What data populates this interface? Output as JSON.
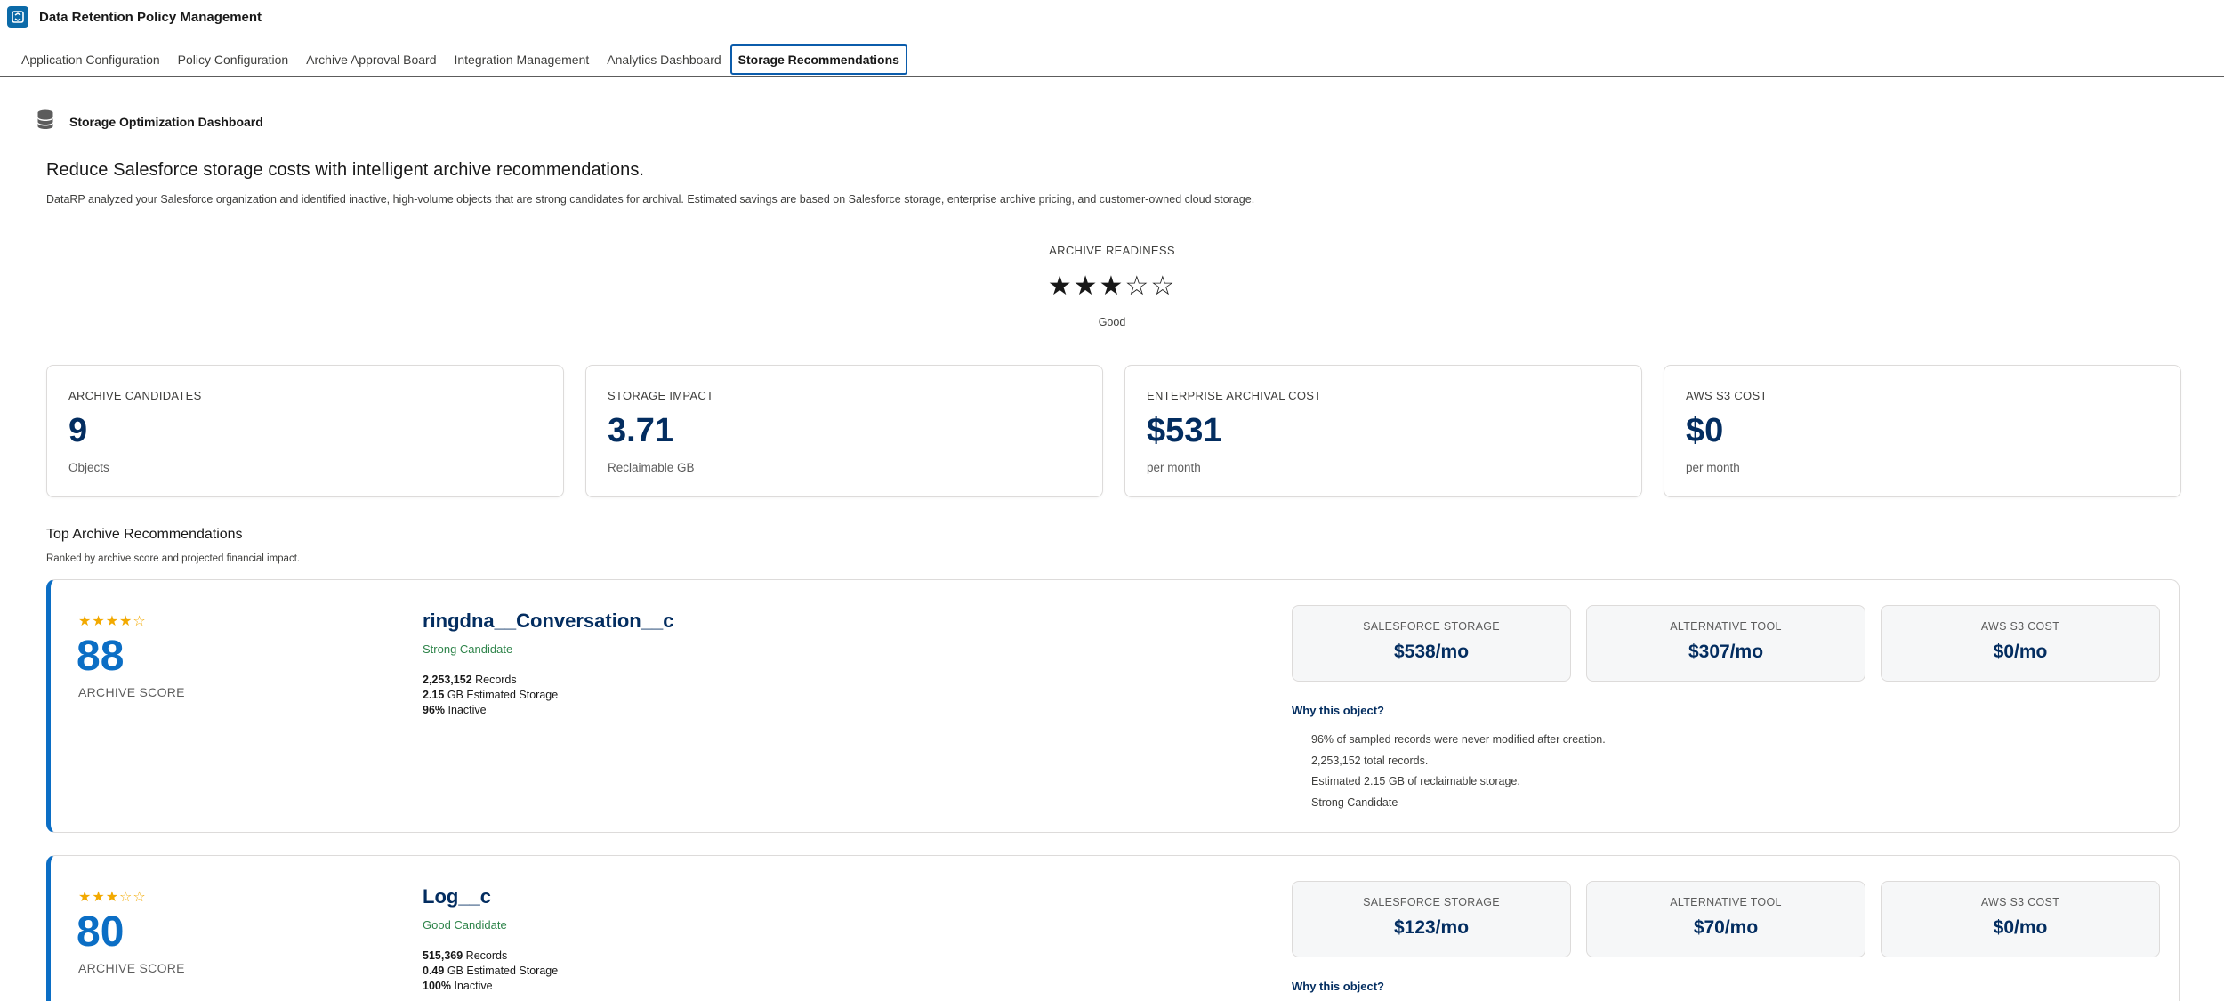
{
  "app": {
    "title": "Data Retention Policy Management",
    "logo_icon": "app-logo-icon"
  },
  "tabs": [
    {
      "label": "Application Configuration",
      "active": false
    },
    {
      "label": "Policy Configuration",
      "active": false
    },
    {
      "label": "Archive Approval Board",
      "active": false
    },
    {
      "label": "Integration Management",
      "active": false
    },
    {
      "label": "Analytics Dashboard",
      "active": false
    },
    {
      "label": "Storage Recommendations",
      "active": true
    }
  ],
  "dashboard": {
    "title": "Storage Optimization Dashboard",
    "title_icon": "database-icon",
    "headline": "Reduce Salesforce storage costs with intelligent archive recommendations.",
    "description": "DataRP analyzed your Salesforce organization and identified inactive, high-volume objects that are strong candidates for archival. Estimated savings are based on Salesforce storage, enterprise archive pricing, and customer-owned cloud storage."
  },
  "readiness": {
    "label": "ARCHIVE READINESS",
    "stars": 3,
    "max_stars": 5,
    "rating": "Good"
  },
  "kpis": [
    {
      "label": "ARCHIVE CANDIDATES",
      "value": "9",
      "sub": "Objects"
    },
    {
      "label": "STORAGE IMPACT",
      "value": "3.71",
      "sub": "Reclaimable GB"
    },
    {
      "label": "ENTERPRISE ARCHIVAL COST",
      "value": "$531",
      "sub": "per month"
    },
    {
      "label": "AWS S3 COST",
      "value": "$0",
      "sub": "per month"
    }
  ],
  "recommendations_section": {
    "title": "Top Archive Recommendations",
    "subtitle": "Ranked by archive score and projected financial impact."
  },
  "recommendations": [
    {
      "stars": 4,
      "score": "88",
      "score_label": "ARCHIVE SCORE",
      "name": "ringdna__Conversation__c",
      "tag": "Strong Candidate",
      "records": "2,253,152",
      "records_label": "Records",
      "storage": "2.15",
      "storage_label": "GB Estimated Storage",
      "inactive": "96%",
      "inactive_label": "Inactive",
      "costs": [
        {
          "label": "SALESFORCE STORAGE",
          "value": "$538/mo"
        },
        {
          "label": "ALTERNATIVE TOOL",
          "value": "$307/mo"
        },
        {
          "label": "AWS S3 COST",
          "value": "$0/mo"
        }
      ],
      "why_title": "Why this object?",
      "why": [
        "96% of sampled records were never modified after creation.",
        "2,253,152 total records.",
        "Estimated 2.15 GB of reclaimable storage.",
        "Strong Candidate"
      ]
    },
    {
      "stars": 3,
      "score": "80",
      "score_label": "ARCHIVE SCORE",
      "name": "Log__c",
      "tag": "Good Candidate",
      "records": "515,369",
      "records_label": "Records",
      "storage": "0.49",
      "storage_label": "GB Estimated Storage",
      "inactive": "100%",
      "inactive_label": "Inactive",
      "costs": [
        {
          "label": "SALESFORCE STORAGE",
          "value": "$123/mo"
        },
        {
          "label": "ALTERNATIVE TOOL",
          "value": "$70/mo"
        },
        {
          "label": "AWS S3 COST",
          "value": "$0/mo"
        }
      ],
      "why_title": "Why this object?",
      "why": []
    }
  ],
  "colors": {
    "accent": "#0b6ec5",
    "navy": "#032d60",
    "success": "#2e844a",
    "star": "#f2a900"
  }
}
